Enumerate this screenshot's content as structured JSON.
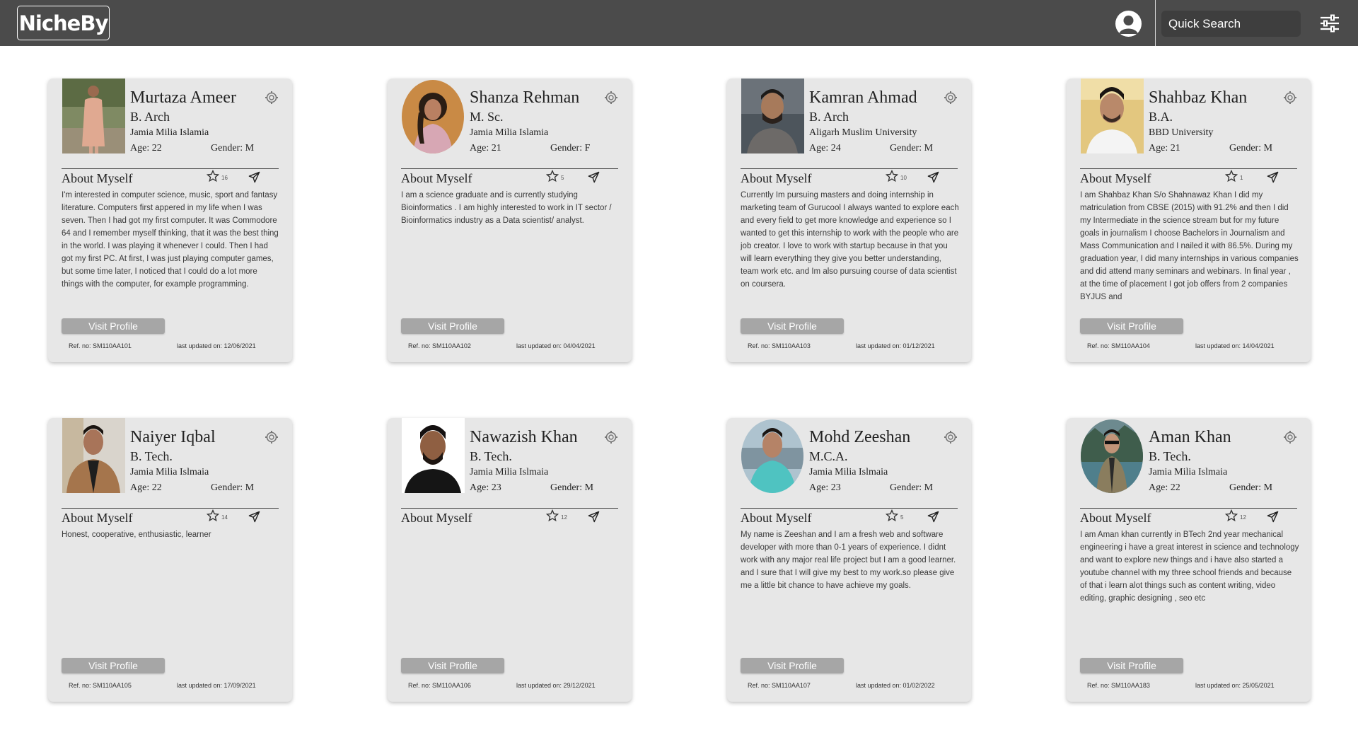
{
  "header": {
    "logo": "NicheBy",
    "search_placeholder": "Quick Search"
  },
  "common": {
    "about_label": "About Myself",
    "visit_label": "Visit Profile"
  },
  "cards": [
    {
      "name": "Murtaza Ameer",
      "degree": "B. Arch",
      "university": "Jamia Milia Islamia",
      "age": "Age: 22",
      "gender": "Gender: M",
      "stars": "16",
      "bio": "I'm interested in computer science, music, sport and fantasy literature. Computers first appered in my life when I was seven. Then I had got my first computer. It was Commodore 64 and I remember myself thinking, that it was the best thing in the world. I was playing it whenever I could. Then I had got my first PC. At first, I was just playing computer games, but some time later, I noticed that I could do a lot more things with the computer, for example programming.",
      "ref": "Ref. no: SM110AA101",
      "updated": "last updated on: 12/06/2021"
    },
    {
      "name": "Shanza Rehman",
      "degree": "M. Sc.",
      "university": "Jamia Milia Islamia",
      "age": "Age: 21",
      "gender": "Gender: F",
      "stars": "5",
      "bio": "I am a science graduate and is currently studying Bioinformatics . I am highly interested to work in IT sector / Bioinformatics industry as a Data scientist/ analyst.",
      "ref": "Ref. no: SM110AA102",
      "updated": "last updated on: 04/04/2021"
    },
    {
      "name": "Kamran Ahmad",
      "degree": "B. Arch",
      "university": "Aligarh Muslim University",
      "age": "Age: 24",
      "gender": "Gender: M",
      "stars": "10",
      "bio": "Currently Im pursuing masters and doing internship in marketing team of Gurucool I always wanted to explore each and every field to get more knowledge and experience so I wanted to get this internship to work with the people who are job creator. I love to work with startup because in that you will learn everything they give you better understanding, team work etc. and Im also pursuing course of data scientist on coursera.",
      "ref": "Ref. no: SM110AA103",
      "updated": "last updated on: 01/12/2021"
    },
    {
      "name": "Shahbaz Khan",
      "degree": "B.A.",
      "university": "BBD University",
      "age": "Age: 21",
      "gender": "Gender: M",
      "stars": "1",
      "bio": "I am Shahbaz Khan S/o Shahnawaz Khan I did my matriculation from CBSE (2015) with 91.2% and then I did my Intermediate in the science stream but for my future goals in journalism I choose Bachelors in Journalism and Mass Communication and I nailed it with 86.5%. During my graduation year, I did many internships in various companies and did attend many seminars and webinars. In final year , at the time of placement I got job offers from 2 companies BYJUS and",
      "ref": "Ref. no: SM110AA104",
      "updated": "last updated on: 14/04/2021"
    },
    {
      "name": "Naiyer Iqbal",
      "degree": "B. Tech.",
      "university": "Jamia Milia Islmaia",
      "age": "Age: 22",
      "gender": "Gender: M",
      "stars": "14",
      "bio": "Honest, cooperative, enthusiastic, learner",
      "ref": "Ref. no: SM110AA105",
      "updated": "last updated on: 17/09/2021"
    },
    {
      "name": "Nawazish Khan",
      "degree": "B. Tech.",
      "university": "Jamia Milia Islmaia",
      "age": "Age: 23",
      "gender": "Gender: M",
      "stars": "12",
      "bio": "",
      "ref": "Ref. no: SM110AA106",
      "updated": "last updated on: 29/12/2021"
    },
    {
      "name": "Mohd Zeeshan",
      "degree": "M.C.A.",
      "university": "Jamia Milia Islmaia",
      "age": "Age: 23",
      "gender": "Gender: M",
      "stars": "5",
      "bio": "My name is Zeeshan and I am a fresh web and software developer with more than 0-1 years of experience. I didnt work with any major real life project but I am a good learner. and I sure that I will give my best to my work.so please give me a little bit chance to have achieve my goals.",
      "ref": "Ref. no: SM110AA107",
      "updated": "last updated on: 01/02/2022"
    },
    {
      "name": "Aman Khan",
      "degree": "B. Tech.",
      "university": "Jamia Milia Islmaia",
      "age": "Age: 22",
      "gender": "Gender: M",
      "stars": "12",
      "bio": "I am Aman khan currently in BTech 2nd year mechanical engineering i have a great interest in science and technology and want to explore new things and i have also started a youtube channel with my three school friends and because of that i learn alot things such as content writing, video editing, graphic designing , seo etc",
      "ref": "Ref. no: SM110AA183",
      "updated": "last updated on: 25/05/2021"
    }
  ]
}
